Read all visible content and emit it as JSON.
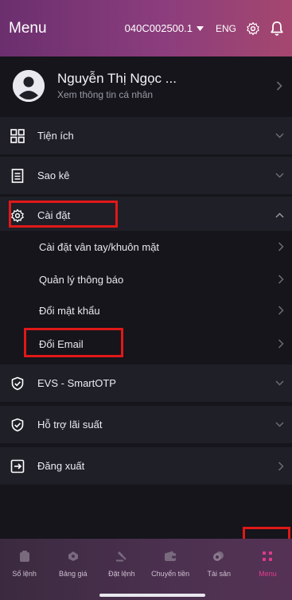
{
  "header": {
    "title": "Menu",
    "account": "040C002500.1",
    "language": "ENG"
  },
  "profile": {
    "name": "Nguyễn Thị Ngọc ...",
    "subtitle": "Xem thông tin cá nhân"
  },
  "menu": {
    "utilities": "Tiện ích",
    "statement": "Sao kê",
    "settings": "Cài đặt",
    "settings_items": [
      "Cài đặt vân tay/khuôn mặt",
      "Quản lý thông báo",
      "Đổi mật khẩu",
      "Đổi Email"
    ],
    "smartotp": "EVS - SmartOTP",
    "margin_support": "Hỗ trợ lãi suất",
    "logout": "Đăng xuất"
  },
  "tabs": [
    "Sổ lệnh",
    "Bảng giá",
    "Đặt lệnh",
    "Chuyển tiền",
    "Tài sản",
    "Menu"
  ],
  "colors": {
    "accent": "#e23a8c",
    "highlight": "#e01818",
    "header_start": "#6b2f6e",
    "header_end": "#a5476f"
  }
}
